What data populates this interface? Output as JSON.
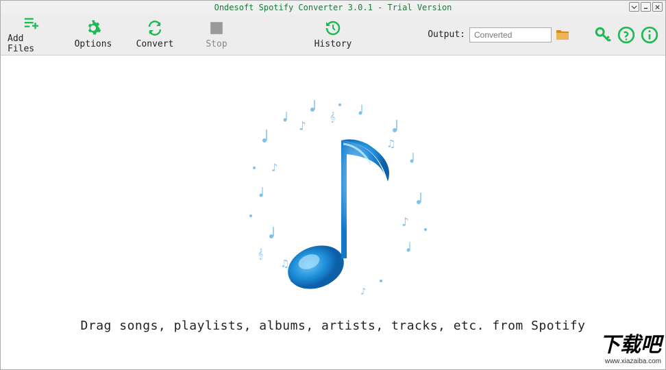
{
  "title": "Ondesoft Spotify Converter 3.0.1 - Trial Version",
  "toolbar": {
    "add_files": "Add Files",
    "options": "Options",
    "convert": "Convert",
    "stop": "Stop",
    "history": "History"
  },
  "output": {
    "label": "Output:",
    "placeholder": "Converted"
  },
  "hint": "Drag songs, playlists, albums, artists, tracks, etc. from Spotify",
  "watermark": {
    "big": "下载吧",
    "small": "www.xiazaiba.com"
  },
  "colors": {
    "accent": "#1fb954",
    "disabled": "#9a9a9a",
    "folder": "#d88a1e"
  }
}
